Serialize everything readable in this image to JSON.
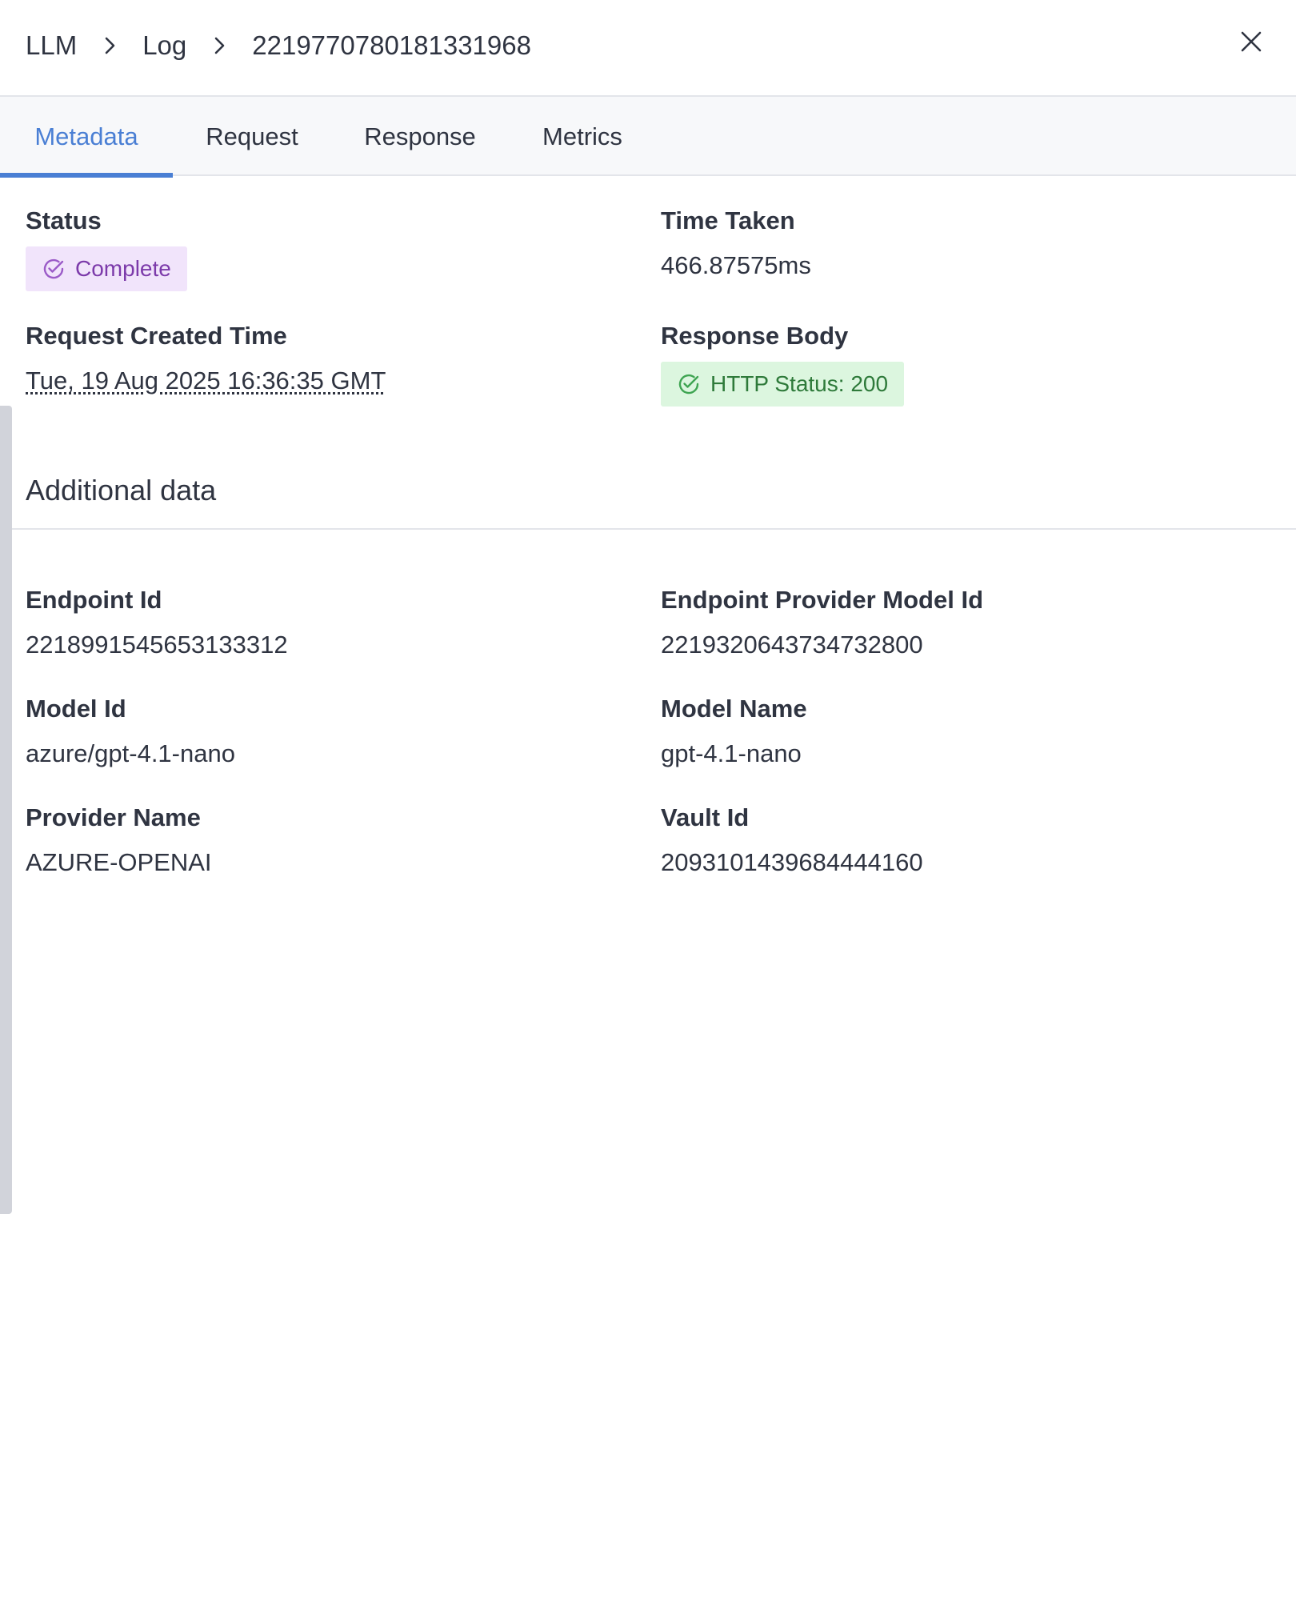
{
  "breadcrumb": {
    "items": [
      "LLM",
      "Log",
      "2219770780181331968"
    ]
  },
  "header": {
    "close_icon": "close-icon"
  },
  "tabs": [
    {
      "label": "Metadata",
      "active": true
    },
    {
      "label": "Request",
      "active": false
    },
    {
      "label": "Response",
      "active": false
    },
    {
      "label": "Metrics",
      "active": false
    }
  ],
  "metadata": {
    "status": {
      "label": "Status",
      "value": "Complete",
      "icon": "check-circle-icon",
      "color": "#7c3aaa",
      "bg": "#f1e4fb"
    },
    "time_taken": {
      "label": "Time Taken",
      "value": "466.87575ms"
    },
    "request_created_time": {
      "label": "Request Created Time",
      "value": "Tue, 19 Aug 2025 16:36:35 GMT"
    },
    "response_body": {
      "label": "Response Body",
      "value": "HTTP Status: 200",
      "icon": "check-circle-icon",
      "color": "#2e7a3a",
      "bg": "#dcf6df"
    }
  },
  "additional": {
    "title": "Additional data",
    "fields": [
      {
        "label": "Endpoint Id",
        "value": "2218991545653133312"
      },
      {
        "label": "Endpoint Provider Model Id",
        "value": "2219320643734732800"
      },
      {
        "label": "Model Id",
        "value": "azure/gpt-4.1-nano"
      },
      {
        "label": "Model Name",
        "value": "gpt-4.1-nano"
      },
      {
        "label": "Provider Name",
        "value": "AZURE-OPENAI"
      },
      {
        "label": "Vault Id",
        "value": "2093101439684444160"
      }
    ]
  },
  "colors": {
    "accent": "#4a7fd4",
    "text": "#2f3441",
    "border": "#e3e5ea"
  }
}
